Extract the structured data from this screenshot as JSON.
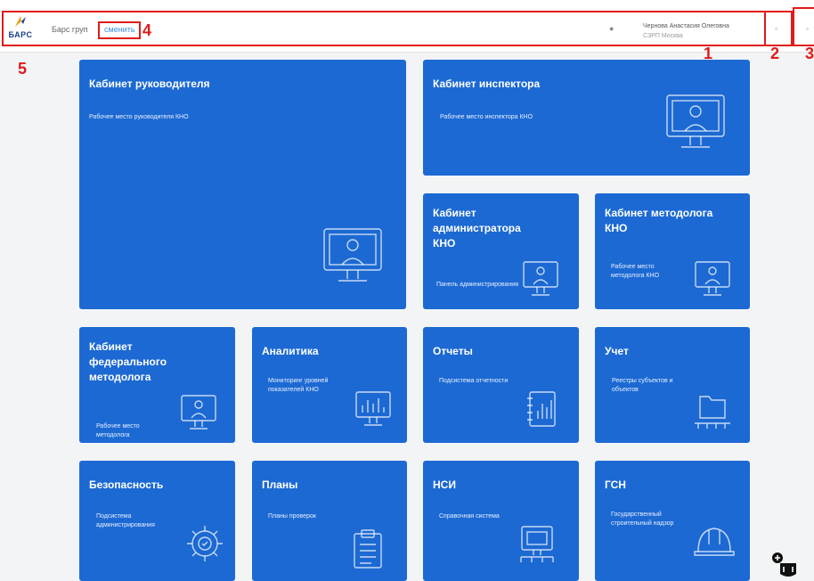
{
  "header": {
    "org_name": "Барс груп",
    "org_link": "сменить",
    "user_name": "Чернова Анастасия Олеговна",
    "user_role": "СЗРП Москва",
    "logo_text": "БАРС"
  },
  "markers": [
    "1",
    "2",
    "3",
    "4",
    "5"
  ],
  "tiles": [
    {
      "title": "Кабинет руководителя",
      "desc": "Рабочее место руководителя КНО",
      "icon": "monitor-person-icon"
    },
    {
      "title": "Кабинет инспектора",
      "desc": "Рабочее место инспектора КНО",
      "icon": "monitor-person-icon"
    },
    {
      "title": "Кабинет администратора КНО",
      "desc": "Панель администрирования",
      "icon": "monitor-person-icon"
    },
    {
      "title": "Кабинет методолога КНО",
      "desc": "Рабочее место методолога КНО",
      "icon": "monitor-person-icon"
    },
    {
      "title": "Кабинет федерального методолога",
      "desc": "Рабочее место методолога",
      "icon": "monitor-person-icon"
    },
    {
      "title": "Аналитика",
      "desc": "Мониторинг уровней показателей КНО",
      "icon": "analytics-monitor-icon"
    },
    {
      "title": "Отчеты",
      "desc": "Подсистема отчетности",
      "icon": "report-notebook-icon"
    },
    {
      "title": "Учет",
      "desc": "Реестры субъектов и объектов",
      "icon": "registry-folder-icon"
    },
    {
      "title": "Безопасность",
      "desc": "Подсистема администрирования",
      "icon": "security-gear-icon"
    },
    {
      "title": "Планы",
      "desc": "Планы проверок",
      "icon": "clipboard-icon"
    },
    {
      "title": "НСИ",
      "desc": "Справочная система",
      "icon": "reference-monitor-icon"
    },
    {
      "title": "ГСН",
      "desc": "Государственный строительный надзор",
      "icon": "hard-hat-icon"
    }
  ]
}
